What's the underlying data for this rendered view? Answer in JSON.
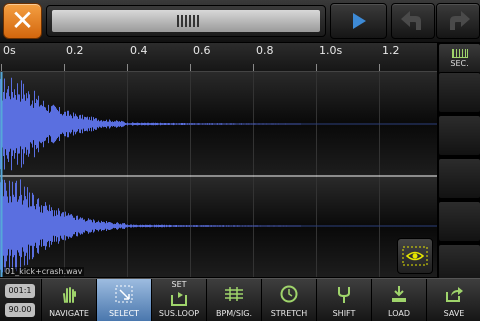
{
  "topbar": {
    "close_icon": "close-icon",
    "play_icon": "play-icon",
    "undo_icon": "undo-arrow-icon",
    "redo_icon": "redo-arrow-icon"
  },
  "ruler": {
    "ticks": [
      "0s",
      "0.2",
      "0.4",
      "0.6",
      "0.8",
      "1.0s",
      "1.2"
    ],
    "unit_button": "SEC."
  },
  "file_label": "01_kick+crash.wav",
  "position": {
    "time": "001:1",
    "tempo": "90.00"
  },
  "toolbar": {
    "navigate": "NAVIGATE",
    "select": "SELECT",
    "set_sus_loop_top": "SET",
    "sus_loop": "SUS.LOOP",
    "bpm_sig": "BPM/SIG.",
    "stretch": "STRETCH",
    "shift": "SHIFT",
    "load": "LOAD",
    "save": "SAVE",
    "selected_tool": "SELECT"
  },
  "colors": {
    "accent_orange": "#e8801d",
    "selected_blue": "#6d93c4",
    "wave_blue": "#5a6fe0",
    "icon_green": "#9fd46b",
    "icon_yellow": "#e6e600"
  }
}
